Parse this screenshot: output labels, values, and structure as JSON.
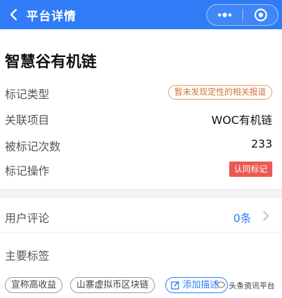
{
  "header": {
    "title": "平台详情",
    "bg_color": "#2f7cf6"
  },
  "page": {
    "title": "智慧谷有机链"
  },
  "rows": {
    "mark_type": {
      "label": "标记类型",
      "value": "暂未发现定性的相关报道"
    },
    "project": {
      "label": "关联项目",
      "value": "WOC有机链"
    },
    "mark_count": {
      "label": "被标记次数",
      "value": "233"
    },
    "mark_action": {
      "label": "标记操作",
      "button": "认同标记"
    }
  },
  "comments": {
    "label": "用户评论",
    "count": "0条"
  },
  "tags": {
    "label": "主要标签",
    "items": [
      "宣称高收益",
      "山寨虚拟币区块链"
    ],
    "add_label": "添加描述"
  },
  "watermark": {
    "text": "头条资讯平台"
  },
  "icons": {
    "back": "chevron-left-icon",
    "more": "more-dots-icon",
    "close": "target-close-icon",
    "chevron": "chevron-right-icon",
    "edit": "edit-icon"
  },
  "colors": {
    "accent": "#2f7cf6",
    "warning": "#d4703a",
    "danger": "#ea5a52"
  }
}
